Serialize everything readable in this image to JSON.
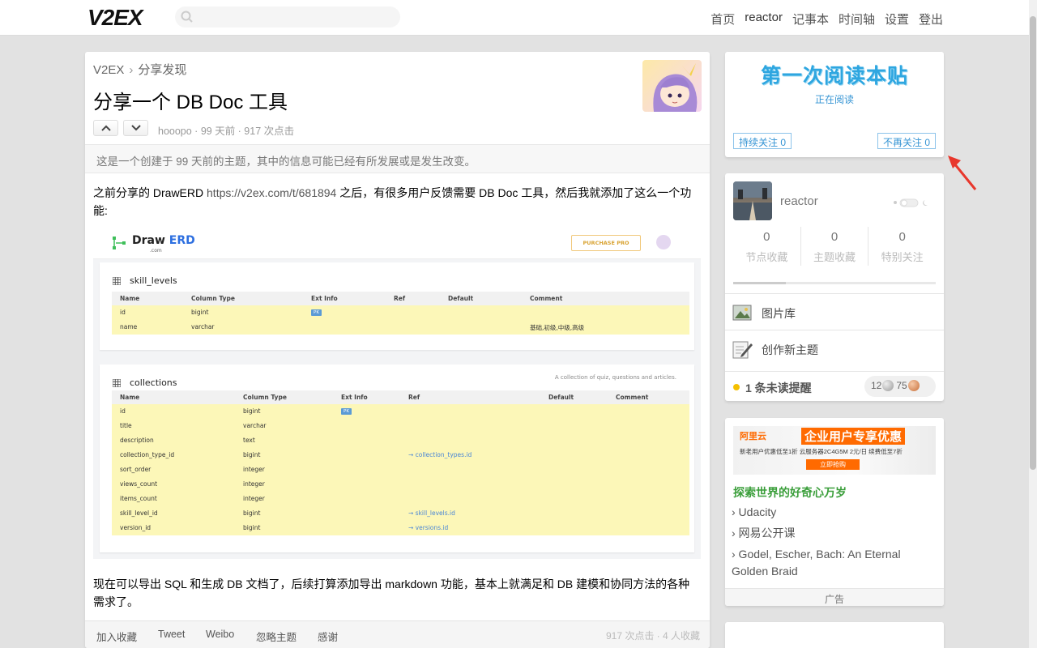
{
  "header": {
    "logo": "V2EX",
    "nav": [
      "首页",
      "reactor",
      "记事本",
      "时间轴",
      "设置",
      "登出"
    ]
  },
  "topic": {
    "breadcrumb": [
      "V2EX",
      "分享发现"
    ],
    "breadcrumb_sep": "›",
    "title": "分享一个 DB Doc 工具",
    "meta": "hooopo · 99 天前 · 917 次点击",
    "outdated_notice": "这是一个创建于 99 天前的主题，其中的信息可能已经有所发展或是发生改变。",
    "para1_pre": "之前分享的 DrawERD ",
    "para1_link": "https://v2ex.com/t/681894",
    "para1_post": " 之后，有很多用户反馈需要 DB Doc 工具，然后我就添加了这么一个功能:",
    "para2": "现在可以导出 SQL 和生成 DB 文档了，后续打算添加导出 markdown 功能，基本上就满足和 DB 建模和协同方法的各种需求了。",
    "actions": [
      "加入收藏",
      "Tweet",
      "Weibo",
      "忽略主题",
      "感谢"
    ],
    "stats": "917 次点击 · 4 人收藏"
  },
  "screenshot": {
    "logo_draw": "Draw",
    "logo_erd": "ERD",
    "logo_com": ".com",
    "purchase": "PURCHASE PRO",
    "table1": {
      "name": "skill_levels",
      "headers": [
        "Name",
        "Column Type",
        "Ext Info",
        "Ref",
        "Default",
        "Comment"
      ],
      "rows": [
        [
          "id",
          "bigint",
          "PK",
          "",
          "",
          ""
        ],
        [
          "name",
          "varchar",
          "",
          "",
          "",
          "基础,初级,中级,高级"
        ]
      ]
    },
    "table2": {
      "name": "collections",
      "description": "A collection of quiz, questions and articles.",
      "headers": [
        "Name",
        "Column Type",
        "Ext Info",
        "Ref",
        "Default",
        "Comment"
      ],
      "rows": [
        [
          "id",
          "bigint",
          "PK",
          "",
          "",
          ""
        ],
        [
          "title",
          "varchar",
          "",
          "",
          "",
          ""
        ],
        [
          "description",
          "text",
          "",
          "",
          "",
          ""
        ],
        [
          "collection_type_id",
          "bigint",
          "",
          "→ collection_types.id",
          "",
          ""
        ],
        [
          "sort_order",
          "integer",
          "",
          "",
          "",
          ""
        ],
        [
          "views_count",
          "integer",
          "",
          "",
          "",
          ""
        ],
        [
          "items_count",
          "integer",
          "",
          "",
          "",
          ""
        ],
        [
          "skill_level_id",
          "bigint",
          "",
          "→ skill_levels.id",
          "",
          ""
        ],
        [
          "version_id",
          "bigint",
          "",
          "→ versions.id",
          "",
          ""
        ]
      ]
    }
  },
  "sidebar": {
    "read_title": "第一次阅读本贴",
    "reading": "正在阅读",
    "follow_btn": "持续关注 0",
    "unfollow_btn": "不再关注 0",
    "user": {
      "name": "reactor",
      "stats": [
        {
          "num": "0",
          "label": "节点收藏"
        },
        {
          "num": "0",
          "label": "主题收藏"
        },
        {
          "num": "0",
          "label": "特别关注"
        }
      ],
      "progress": 0.26
    },
    "links": [
      "图片库",
      "创作新主题"
    ],
    "notice": "1 条未读提醒",
    "silver": "12",
    "bronze": "75",
    "ad": {
      "brand": "阿里云",
      "banner_title": "企业用户专享优惠",
      "banner_sub": "新老用户优惠低至1折  云服务器2C4G5M 2元/日  续费低至7折",
      "banner_btn": "立即抢购",
      "title": "探索世界的好奇心万岁",
      "links": [
        "› Udacity",
        "› 网易公开课",
        "› Godel, Escher, Bach: An Eternal Golden Braid"
      ],
      "footer": "广告"
    }
  },
  "colors": {
    "accent_blue": "#3594d4",
    "ad_green": "#3a9e3a",
    "highlight_yellow": "#fcf7b8",
    "arrow_red": "#e8372c"
  }
}
